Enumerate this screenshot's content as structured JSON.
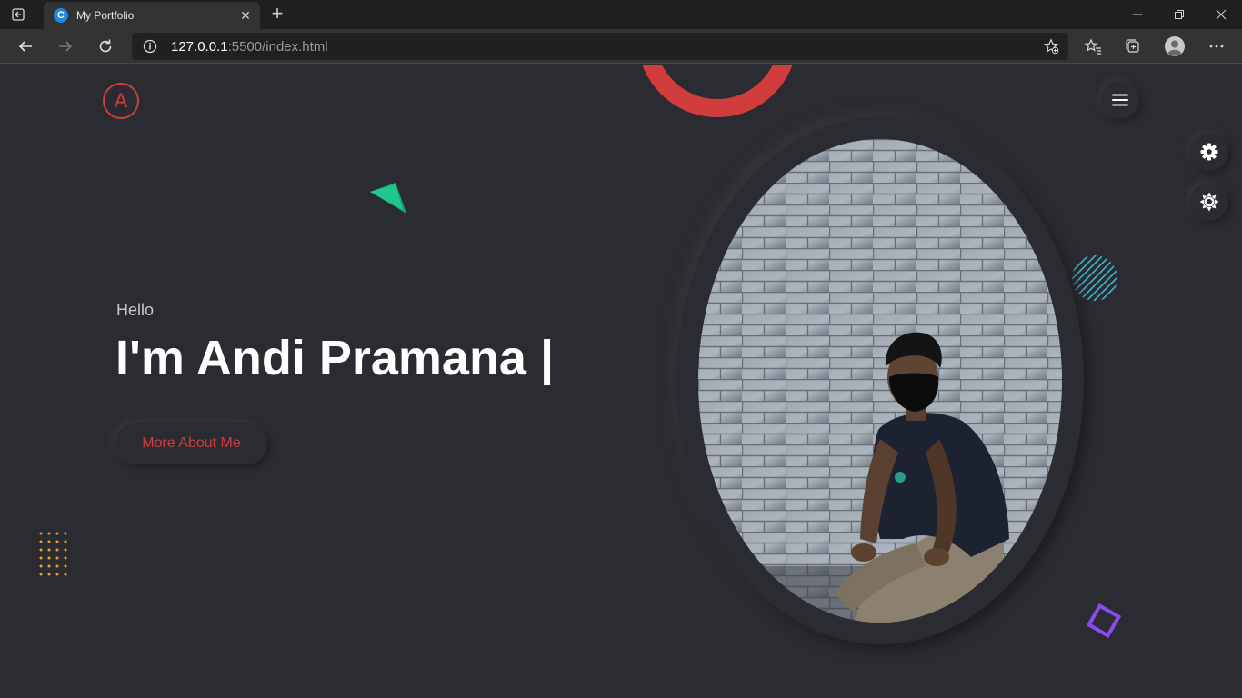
{
  "browser": {
    "tab_title": "My Portfolio",
    "tab_favicon_letter": "C",
    "url_host": "127.0.0.1",
    "url_rest": ":5500/index.html"
  },
  "nav": {
    "logo_letter": "A"
  },
  "hero": {
    "greeting": "Hello",
    "headline": "I'm Andi Pramana |",
    "button_label": "More About Me"
  },
  "colors": {
    "accent": "#d13c3c",
    "background": "#2b2c31",
    "triangle": "#1fc78c",
    "hatched_circle": "#3fb6c9",
    "dots": "#f0a020",
    "square": "#8a4cf0"
  },
  "icons": {
    "menu": "hamburger-icon",
    "settings": "gear-icon",
    "theme": "sun-icon"
  }
}
